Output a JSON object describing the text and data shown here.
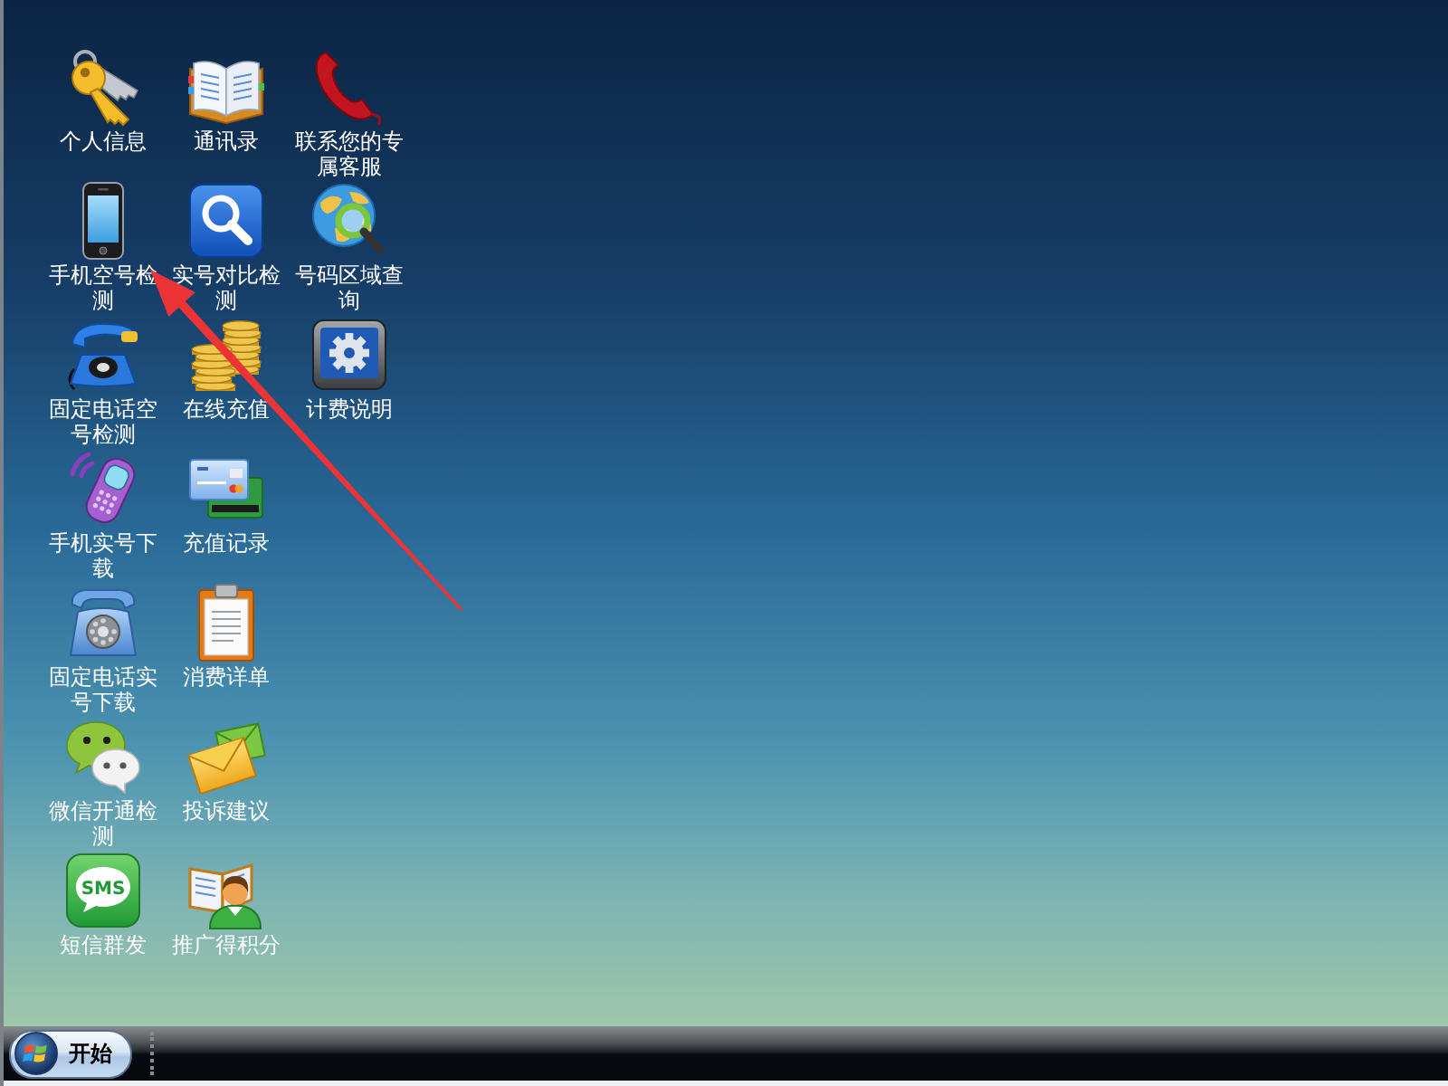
{
  "desktop": {
    "rows": [
      {
        "icons": [
          {
            "label": "个人信息"
          },
          {
            "label": "通讯录"
          },
          {
            "label": "联系您的专属客服"
          }
        ]
      },
      {
        "icons": [
          {
            "label": "手机空号检测"
          },
          {
            "label": "实号对比检测"
          },
          {
            "label": "号码区域查询"
          }
        ]
      },
      {
        "icons": [
          {
            "label": "固定电话空号检测"
          },
          {
            "label": "在线充值"
          },
          {
            "label": "计费说明"
          }
        ]
      },
      {
        "icons": [
          {
            "label": "手机实号下载"
          },
          {
            "label": "充值记录"
          }
        ]
      },
      {
        "icons": [
          {
            "label": "固定电话实号下载"
          },
          {
            "label": "消费详单"
          }
        ]
      },
      {
        "icons": [
          {
            "label": "微信开通检测"
          },
          {
            "label": "投诉建议"
          }
        ]
      },
      {
        "icons": [
          {
            "label": "短信群发",
            "icon_text": "SMS"
          },
          {
            "label": "推广得积分"
          }
        ]
      }
    ]
  },
  "taskbar": {
    "start_button": {
      "label": "开始"
    }
  }
}
